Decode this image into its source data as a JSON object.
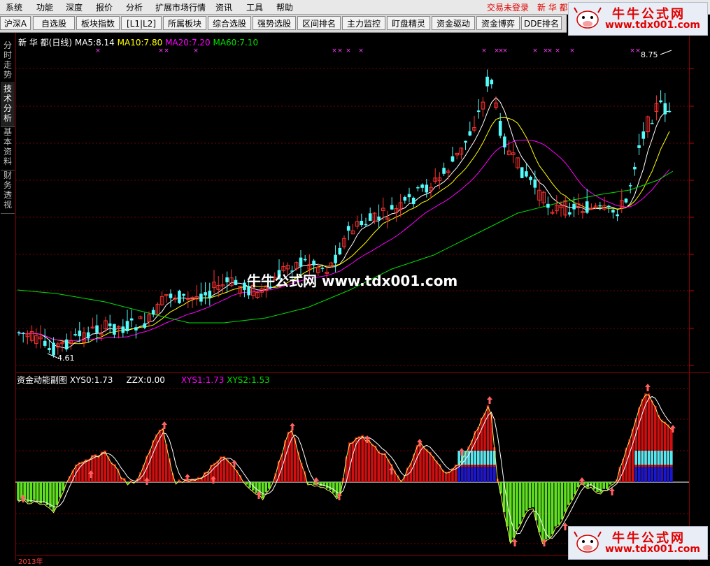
{
  "menu": {
    "items": [
      "系统",
      "功能",
      "深度",
      "报价",
      "分析",
      "扩展市场行情",
      "资讯",
      "工具",
      "帮助"
    ],
    "status_text": "交易未登录",
    "stock_prefix": "新 华 都"
  },
  "toolbar": {
    "buttons": [
      "沪深A股",
      "自选股",
      "板块指数",
      "[L1|L2]",
      "所属板块",
      "综合选股",
      "强势选股",
      "区间排名",
      "主力监控",
      "盯盘精灵",
      "资金驱动",
      "资金博弈",
      "DDE排名"
    ]
  },
  "logo": {
    "name": "牛牛公式网",
    "url": "www.tdx001.com"
  },
  "side_tabs": [
    "分时走势",
    "技术分析",
    "基本资料",
    "财务透视"
  ],
  "main_chart": {
    "stock_name": "新 华 都",
    "period": "(日线)",
    "ma5_label": "MA5:",
    "ma5_value": "8.14",
    "ma10_label": "MA10:",
    "ma10_value": "7.80",
    "ma20_label": "MA20:",
    "ma20_value": "7.20",
    "ma60_label": "MA60:",
    "ma60_value": "7.10",
    "high_label": "8.75",
    "low_label": "4.61",
    "colors": {
      "up": "#ff3232",
      "down": "#54fcfc",
      "ma5": "#ffffff",
      "ma10": "#ffff00",
      "ma20": "#ff00ff",
      "ma60": "#00e000"
    }
  },
  "indicator": {
    "name": "资金动能副图",
    "xys0_label": "XYS0:",
    "xys0_value": "1.73",
    "zzx_label": "ZZX:",
    "zzx_value": "0.00",
    "xys1_label": "XYS1:",
    "xys1_value": "1.73",
    "xys2_label": "XYS2:",
    "xys2_value": "1.53"
  },
  "watermark": "牛牛公式网  www.tdx001.com",
  "bottom_axis_label": "2013年"
}
